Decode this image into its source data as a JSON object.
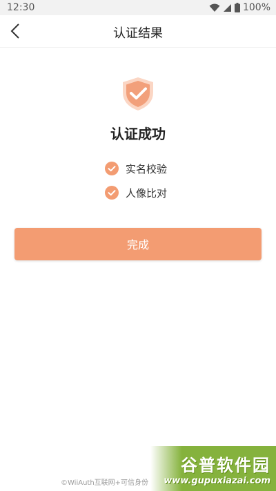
{
  "status_bar": {
    "time": "12:30",
    "battery": "100%",
    "icons": [
      "wifi-icon",
      "signal-icon",
      "battery-icon"
    ]
  },
  "header": {
    "back_icon": "chevron-left-icon",
    "title": "认证结果"
  },
  "result": {
    "icon": "shield-check-icon",
    "title": "认证成功",
    "checks": [
      {
        "label": "实名校验",
        "icon": "check-circle-icon"
      },
      {
        "label": "人像比对",
        "icon": "check-circle-icon"
      }
    ]
  },
  "actions": {
    "done_label": "完成"
  },
  "footer": {
    "text": "©WiiAuth互联网+可信身份"
  },
  "watermark": {
    "title": "谷普软件园",
    "url": "www.gupuxiazai.com"
  },
  "colors": {
    "accent": "#f39c72",
    "shield": "#f2a07b",
    "check": "#f39c72"
  }
}
